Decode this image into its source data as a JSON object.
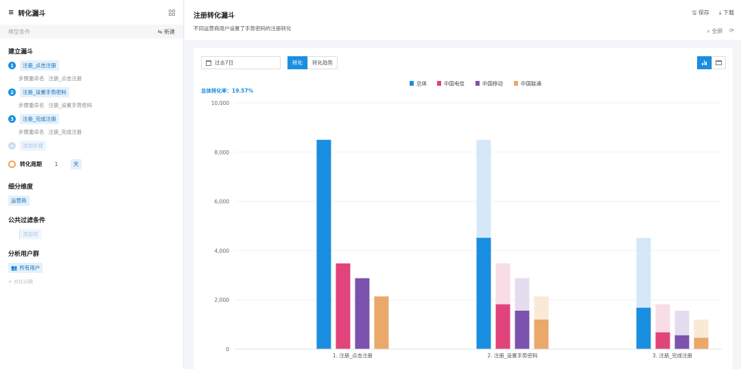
{
  "sidebar": {
    "title": "转化漏斗",
    "model_label": "模型条件",
    "new_label": "新建",
    "section_build": "建立漏斗",
    "steps": [
      {
        "num": "1",
        "name": "注册_点击注册",
        "rename_label": "步骤重命名",
        "rename_value": "注册_点击注册"
      },
      {
        "num": "2",
        "name": "注册_设置手势密码",
        "rename_label": "步骤重命名",
        "rename_value": "注册_设置手势密码"
      },
      {
        "num": "3",
        "name": "注册_完成注册",
        "rename_label": "步骤重命名",
        "rename_value": "注册_完成注册"
      }
    ],
    "add_step": "添加步骤",
    "cycle_label": "转化周期",
    "cycle_value": "1",
    "cycle_unit": "天",
    "section_dimension": "细分维度",
    "dimension_value": "运营商",
    "section_filter": "公共过滤条件",
    "filter_add": "添加项",
    "section_group": "分析用户群",
    "group_value": "所有用户",
    "compare_label": "对比分群"
  },
  "header": {
    "title": "注册转化漏斗",
    "subtitle": "不同运营商用户设置了手势密码的注册转化",
    "save": "保存",
    "download": "下载",
    "fullscreen": "全屏"
  },
  "toolbar": {
    "date_range": "过去7日",
    "tab_conversion": "转化",
    "tab_trend": "转化趋势"
  },
  "chart_data": {
    "type": "bar",
    "overall_rate_label": "总体转化率：19.57%",
    "categories": [
      "1. 注册_点击注册",
      "2. 注册_设置手势密码",
      "3. 注册_完成注册"
    ],
    "ylim": [
      0,
      10000
    ],
    "yticks": [
      "0",
      "2,000",
      "4,000",
      "6,000",
      "8,000",
      "10,000"
    ],
    "ytick_values": [
      0,
      2000,
      4000,
      6000,
      8000,
      10000
    ],
    "legend_position": "top-center",
    "series": [
      {
        "name": "总体",
        "color": "#1a8ee0",
        "ghost": "#d6e8f7",
        "values": [
          8500,
          4520,
          1680
        ],
        "base": [
          8500,
          8500,
          4520
        ]
      },
      {
        "name": "中国电信",
        "color": "#e0447a",
        "ghost": "#f8dce6",
        "values": [
          3480,
          1820,
          680
        ],
        "base": [
          3480,
          3480,
          1820
        ]
      },
      {
        "name": "中国移动",
        "color": "#7b52ad",
        "ghost": "#e4dcef",
        "values": [
          2880,
          1560,
          560
        ],
        "base": [
          2880,
          2880,
          1560
        ]
      },
      {
        "name": "中国联通",
        "color": "#eaa86a",
        "ghost": "#fbe9d8",
        "values": [
          2140,
          1200,
          460
        ],
        "base": [
          2140,
          2140,
          1200
        ]
      }
    ]
  }
}
